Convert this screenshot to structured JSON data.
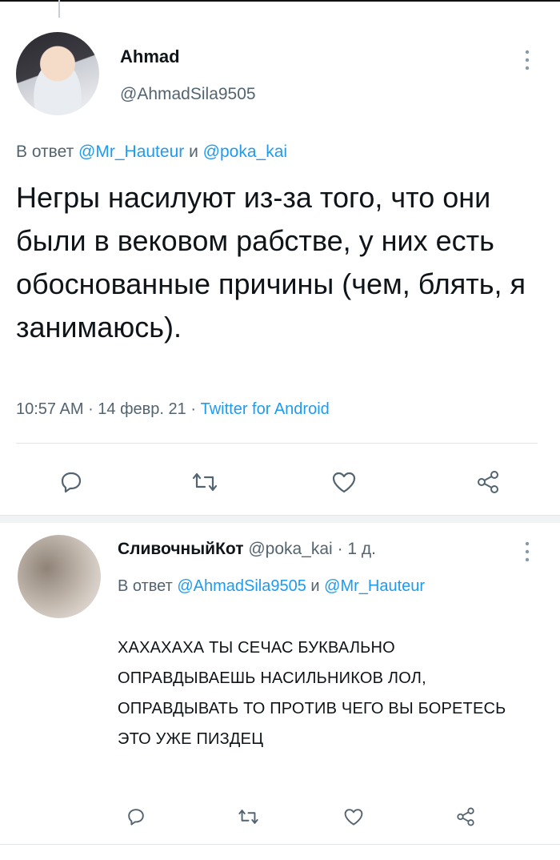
{
  "main_tweet": {
    "author_name": "Ahmad",
    "author_handle": "@AhmadSila9505",
    "reply_prefix": "В ответ",
    "reply_mention_1": "@Mr_Hauteur",
    "reply_and": "и",
    "reply_mention_2": "@poka_kai",
    "text": "Негры насилуют из-за того, что они были в вековом рабстве, у них есть обоснованные причины (чем, блять, я занимаюсь).",
    "time": "10:57 AM",
    "date": "14 февр. 21",
    "client": "Twitter for Android"
  },
  "reply_tweet": {
    "author_name": "СливочныйКот",
    "author_handle": "@poka_kai",
    "age": "1 д.",
    "reply_prefix": "В ответ",
    "reply_mention_1": "@AhmadSila9505",
    "reply_and": "и",
    "reply_mention_2": "@Mr_Hauteur",
    "text": "ХАХАХАХА ТЫ СЕЧАС БУКВАЛЬНО ОПРАВДЫВАЕШЬ НАСИЛЬНИКОВ ЛОЛ, ОПРАВДЫВАТЬ ТО ПРОТИВ ЧЕГО ВЫ БОРЕТЕСЬ ЭТО УЖЕ ПИЗДЕЦ"
  },
  "icons": [
    "reply-icon",
    "retweet-icon",
    "like-icon",
    "share-icon",
    "more-vertical-icon"
  ],
  "colors": {
    "link": "#1d9bf0",
    "secondary_text": "#536471",
    "action_icon": "#536471"
  }
}
